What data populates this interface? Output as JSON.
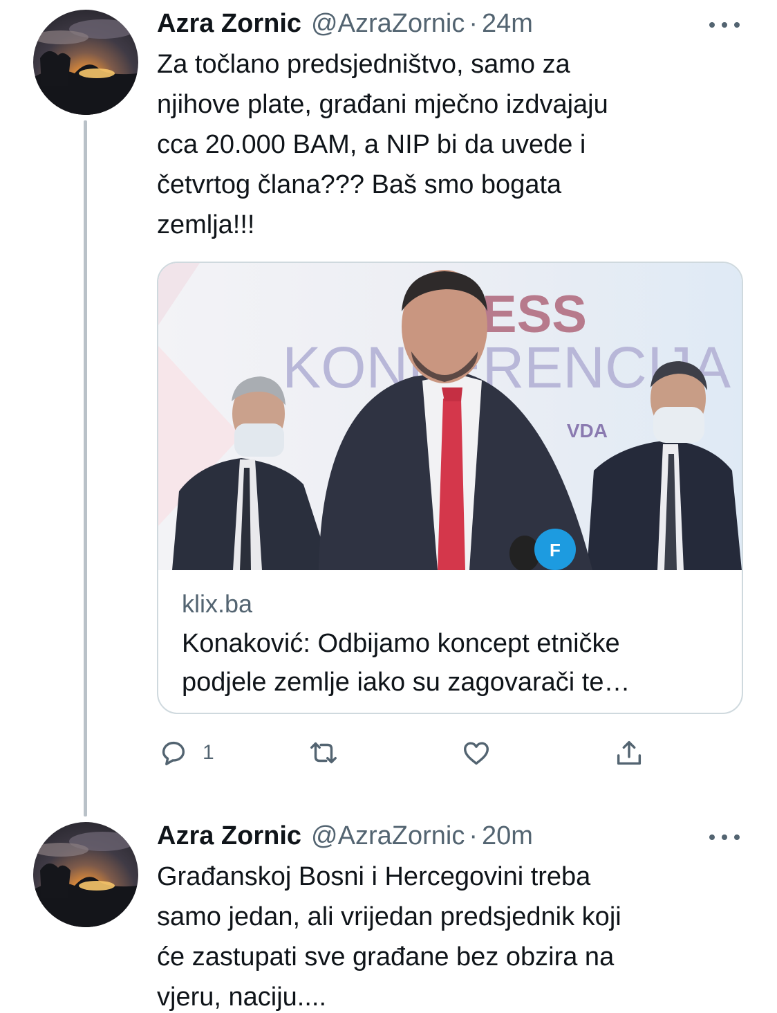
{
  "tweets": [
    {
      "author": {
        "display_name": "Azra Zornic",
        "handle": "@AzraZornic",
        "avatar_icon": "sunset-avatar"
      },
      "separator": "·",
      "time": "24m",
      "text": "Za točlano predsjedništvo, samo za\nnjihove plate, građani mječno izdvajaju\ncca 20.000 BAM, a NIP bi da uvede i\nčetvrtog člana??? Baš smo bogata\nzemlja!!!",
      "link_card": {
        "image_text_line1": "RESS",
        "image_text_line2": "KONFERENCIJA",
        "image_text_line3": "VDA",
        "domain": "klix.ba",
        "title": "Konaković: Odbijamo koncept etničke\npodjele zemlje iako su zagovarači te…"
      },
      "actions": {
        "reply_icon": "comment-icon",
        "reply_count": "1",
        "retweet_icon": "retweet-icon",
        "like_icon": "heart-icon",
        "share_icon": "share-icon"
      }
    },
    {
      "author": {
        "display_name": "Azra Zornic",
        "handle": "@AzraZornic",
        "avatar_icon": "sunset-avatar"
      },
      "separator": "·",
      "time": "20m",
      "text": "Građanskoj Bosni i Hercegovini treba\nsamo jedan, ali vrijedan predsjednik koji\nće zastupati sve građane bez obzira na\nvjeru, naciju...."
    }
  ],
  "colors": {
    "text_primary": "#0f1419",
    "text_secondary": "#536471",
    "card_border": "#cfd9de",
    "thread_line": "#b9c1c8"
  }
}
